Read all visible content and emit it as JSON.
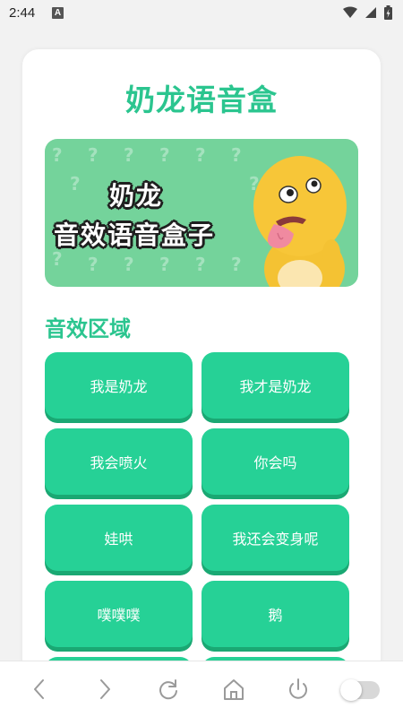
{
  "status_bar": {
    "time": "2:44",
    "notification_icon": "A",
    "icons": [
      "wifi-icon",
      "cellular-icon",
      "battery-icon"
    ]
  },
  "header": {
    "title": "奶龙语音盒"
  },
  "banner": {
    "line1": "奶龙",
    "line2": "音效语音盒子",
    "background_color": "#74d39b",
    "pattern_glyph": "?"
  },
  "section": {
    "title": "音效区域"
  },
  "sound_buttons": [
    {
      "label": "我是奶龙"
    },
    {
      "label": "我才是奶龙"
    },
    {
      "label": "我会喷火"
    },
    {
      "label": "你会吗"
    },
    {
      "label": "娃哄"
    },
    {
      "label": "我还会变身呢"
    },
    {
      "label": "噗噗噗"
    },
    {
      "label": "鹅"
    },
    {
      "label": ""
    },
    {
      "label": ""
    }
  ],
  "nav_bar": {
    "buttons": [
      "back-icon",
      "forward-icon",
      "refresh-icon",
      "home-icon",
      "power-icon",
      "toggle-switch"
    ]
  },
  "colors": {
    "accent": "#2bc58f",
    "button": "#26d196",
    "button_shadow": "#1aa873"
  }
}
